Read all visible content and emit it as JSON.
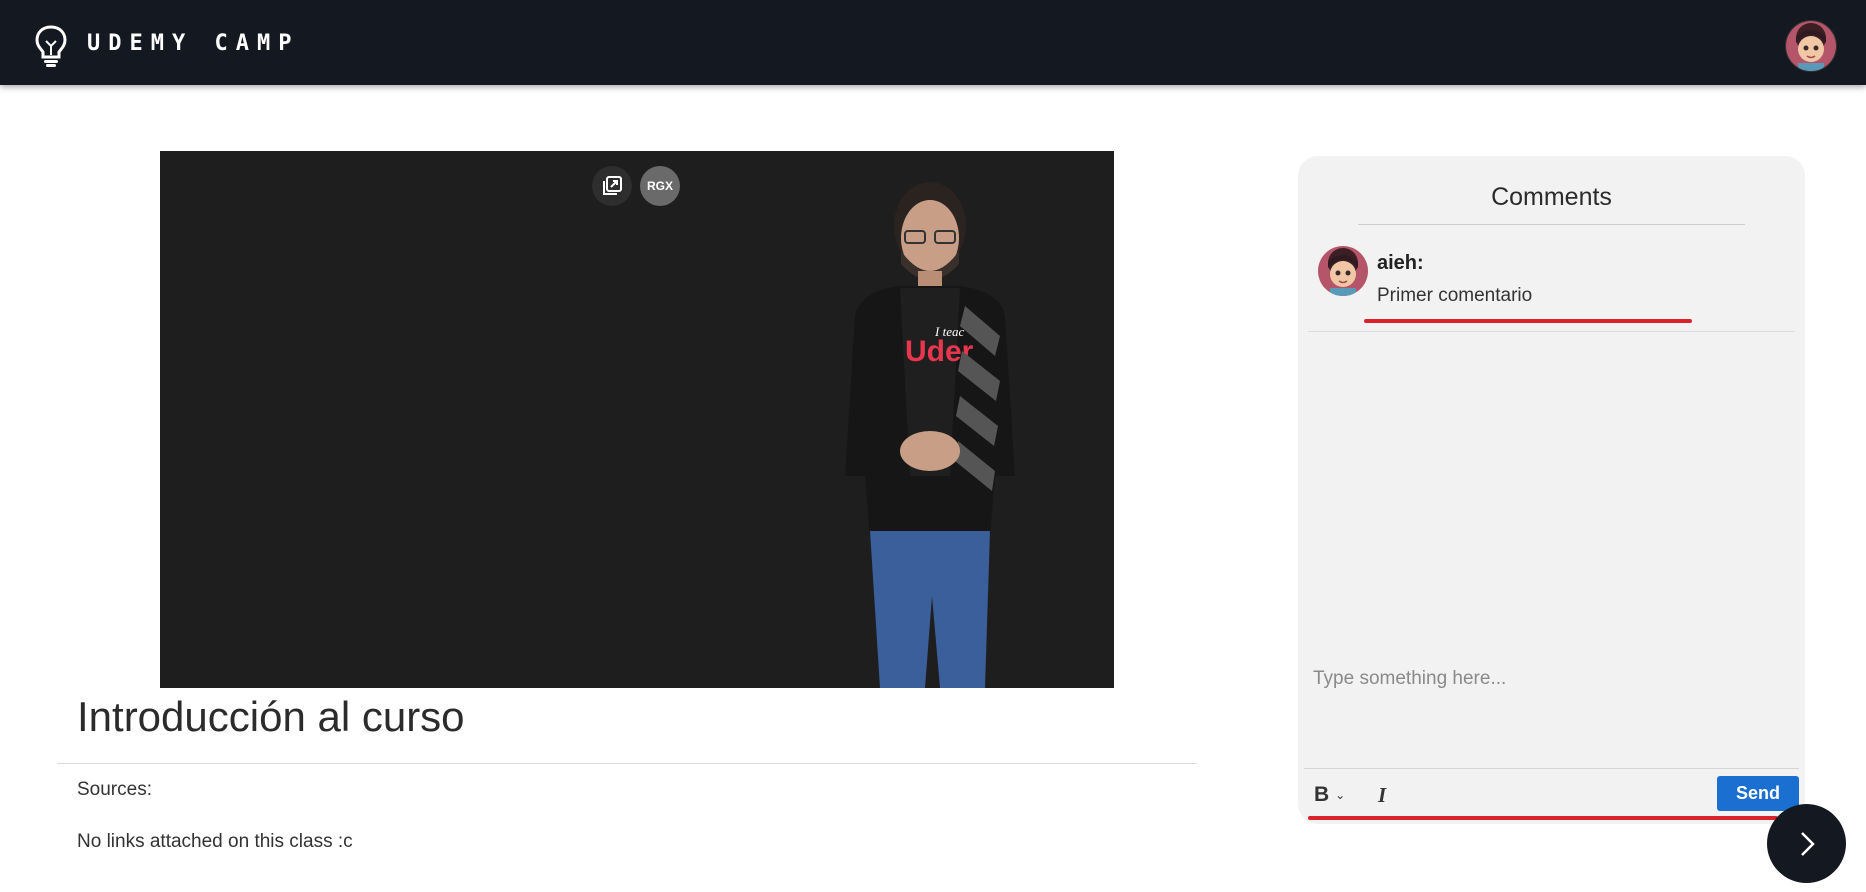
{
  "header": {
    "brand": "UDEMY CAMP",
    "logo_icon": "lightbulb-icon",
    "avatar_icon": "user-avatar"
  },
  "video": {
    "popout_icon": "popout-icon",
    "rgx_label": "RGX"
  },
  "class": {
    "title": "Introducción al curso",
    "sources_label": "Sources:",
    "no_links_text": "No links attached on this class :c"
  },
  "comments": {
    "title": "Comments",
    "items": [
      {
        "user": "aieh:",
        "text": "Primer comentario"
      }
    ],
    "input_placeholder": "Type something here...",
    "bold_label": "B",
    "italic_label": "I",
    "send_label": "Send"
  },
  "navigation": {
    "next_icon": "chevron-right-icon"
  },
  "colors": {
    "topbar": "#141821",
    "accent_blue": "#1a6fd1",
    "underline_red": "#d8232a",
    "panel_bg": "#f2f2f2",
    "video_bg": "#1e1e1e"
  }
}
